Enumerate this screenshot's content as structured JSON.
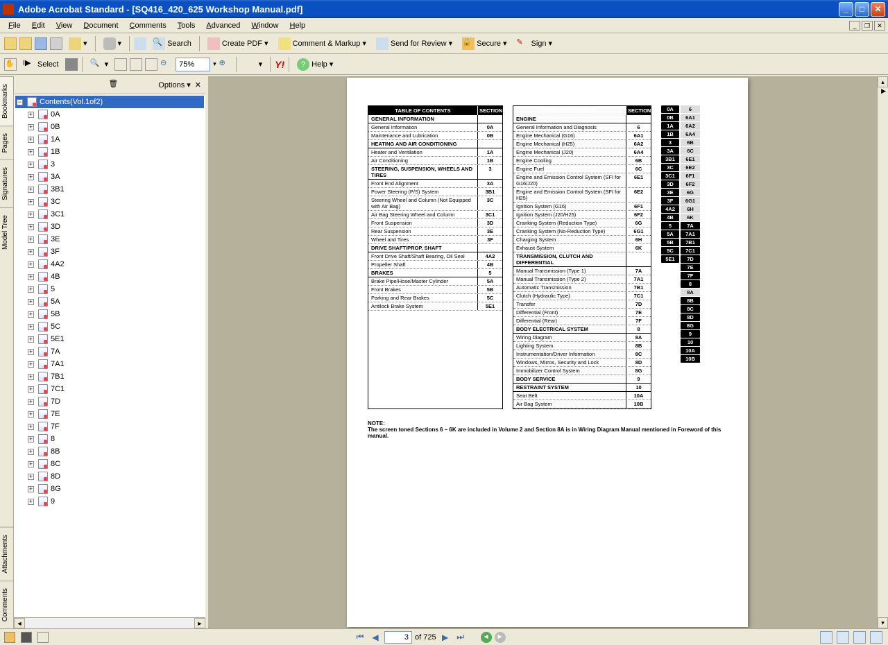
{
  "title": "Adobe Acrobat Standard - [SQ416_420_625 Workshop Manual.pdf]",
  "menu": [
    "File",
    "Edit",
    "View",
    "Document",
    "Comments",
    "Tools",
    "Advanced",
    "Window",
    "Help"
  ],
  "toolbar1": {
    "search": "Search",
    "createpdf": "Create PDF",
    "comment": "Comment & Markup",
    "send": "Send for Review",
    "secure": "Secure",
    "sign": "Sign"
  },
  "toolbar2": {
    "select": "Select",
    "zoom": "75%",
    "help": "Help"
  },
  "nav": {
    "options": "Options",
    "tabs": [
      "Bookmarks",
      "Pages",
      "Signatures",
      "Model Tree",
      "Attachments",
      "Comments"
    ],
    "root": "Contents(Vol.1of2)",
    "items": [
      "0A",
      "0B",
      "1A",
      "1B",
      "3",
      "3A",
      "3B1",
      "3C",
      "3C1",
      "3D",
      "3E",
      "3F",
      "4A2",
      "4B",
      "5",
      "5A",
      "5B",
      "5C",
      "5E1",
      "7A",
      "7A1",
      "7B1",
      "7C1",
      "7D",
      "7E",
      "7F",
      "8",
      "8B",
      "8C",
      "8D",
      "8G",
      "9"
    ]
  },
  "page": {
    "current": "3",
    "total": "of 725"
  },
  "doc": {
    "toc_title": "TABLE OF CONTENTS",
    "section_col": "SECTION",
    "note_label": "NOTE:",
    "note_text": "The screen toned Sections 6 – 6K are included in Volume 2 and Section 8A is in Wiring Diagram Manual mentioned in Foreword of this manual.",
    "toc1": [
      {
        "t": "GENERAL INFORMATION",
        "g": 1
      },
      {
        "t": "General Information",
        "s": "0A"
      },
      {
        "t": "Maintenance and Lubrication",
        "s": "0B"
      },
      {
        "t": "HEATING AND AIR CONDITIONING",
        "g": 1
      },
      {
        "t": "Heater and Ventilation",
        "s": "1A"
      },
      {
        "t": "Air Conditioning",
        "s": "1B"
      },
      {
        "t": "STEERING, SUSPENSION, WHEELS AND TIRES",
        "s": "3",
        "g": 1
      },
      {
        "t": "Front End Alignment",
        "s": "3A"
      },
      {
        "t": "Power Steering (P/S) System",
        "s": "3B1"
      },
      {
        "t": "Steering Wheel and Column (Not Equipped with Air Bag)",
        "s": "3C"
      },
      {
        "t": "Air Bag Steering Wheel and Column",
        "s": "3C1"
      },
      {
        "t": "Front Suspension",
        "s": "3D"
      },
      {
        "t": "Rear Suspension",
        "s": "3E"
      },
      {
        "t": "Wheel and Tires",
        "s": "3F"
      },
      {
        "t": "DRIVE SHAFT/PROP. SHAFT",
        "g": 1
      },
      {
        "t": "Front Drive Shaft/Shaft Bearing, Oil Seal",
        "s": "4A2"
      },
      {
        "t": "Propeller Shaft",
        "s": "4B"
      },
      {
        "t": "BRAKES",
        "s": "5",
        "g": 1
      },
      {
        "t": "Brake Pipe/Hose/Master Cylinder",
        "s": "5A"
      },
      {
        "t": "Front Brakes",
        "s": "5B"
      },
      {
        "t": "Parking and Rear Brakes",
        "s": "5C"
      },
      {
        "t": "Antilock Brake System",
        "s": "5E1"
      }
    ],
    "toc2": [
      {
        "t": "ENGINE",
        "g": 1
      },
      {
        "t": "General Information and Diagnosis",
        "s": "6"
      },
      {
        "t": "Engine Mechanical (G16)",
        "s": "6A1"
      },
      {
        "t": "Engine Mechanical (H25)",
        "s": "6A2"
      },
      {
        "t": "Engine Mechanical (J20)",
        "s": "6A4"
      },
      {
        "t": "Engine Cooling",
        "s": "6B"
      },
      {
        "t": "Engine Fuel",
        "s": "6C"
      },
      {
        "t": "Engine and Emission Control System (SFI for G16/J20)",
        "s": "6E1"
      },
      {
        "t": "Engine and Emission Control System (SFI for H25)",
        "s": "6E2"
      },
      {
        "t": "Ignition System (G16)",
        "s": "6F1"
      },
      {
        "t": "Ignition System (J20/H25)",
        "s": "6F2"
      },
      {
        "t": "Cranking System (Reduction Type)",
        "s": "6G"
      },
      {
        "t": "Cranking System (No-Reduction Type)",
        "s": "6G1"
      },
      {
        "t": "Charging System",
        "s": "6H"
      },
      {
        "t": "Exhaust System",
        "s": "6K"
      },
      {
        "t": "TRANSMISSION, CLUTCH AND DIFFERENTIAL",
        "g": 1
      },
      {
        "t": "Manual Transmission (Type 1)",
        "s": "7A"
      },
      {
        "t": "Manual Transmission (Type 2)",
        "s": "7A1"
      },
      {
        "t": "Automatic Transmission",
        "s": "7B1"
      },
      {
        "t": "Clutch (Hydraulic Type)",
        "s": "7C1"
      },
      {
        "t": "Transfer",
        "s": "7D"
      },
      {
        "t": "Differential (Front)",
        "s": "7E"
      },
      {
        "t": "Differential (Rear)",
        "s": "7F"
      },
      {
        "t": "BODY ELECTRICAL SYSTEM",
        "s": "8",
        "g": 1
      },
      {
        "t": "Wiring Diagram",
        "s": "8A"
      },
      {
        "t": "Lighting System",
        "s": "8B"
      },
      {
        "t": "Instrumentation/Driver Information",
        "s": "8C"
      },
      {
        "t": "Windows, Mirros, Security and Lock",
        "s": "8D"
      },
      {
        "t": "Immobilizer Control System",
        "s": "8G"
      },
      {
        "t": "BODY SERVICE",
        "s": "9",
        "g": 1
      },
      {
        "t": "RESTRAINT SYSTEM",
        "s": "10",
        "g": 1
      },
      {
        "t": "Seat Belt",
        "s": "10A"
      },
      {
        "t": "Air Bag System",
        "s": "10B"
      }
    ],
    "tabs_col1": [
      "0A",
      "0B",
      "1A",
      "1B",
      "3",
      "3A",
      "3B1",
      "3C",
      "3C1",
      "3D",
      "3E",
      "3F",
      "4A2",
      "4B",
      "5",
      "5A",
      "5B",
      "5C",
      "5E1"
    ],
    "tabs_col2": [
      "6",
      "6A1",
      "6A2",
      "6A4",
      "6B",
      "6C",
      "6E1",
      "6E2",
      "6F1",
      "6F2",
      "6G",
      "6G1",
      "6H",
      "6K",
      "7A",
      "7A1",
      "7B1",
      "7C1",
      "7D",
      "7E",
      "7F",
      "8",
      "8A",
      "8B",
      "8C",
      "8D",
      "8G",
      "9",
      "10",
      "10A",
      "10B"
    ]
  }
}
